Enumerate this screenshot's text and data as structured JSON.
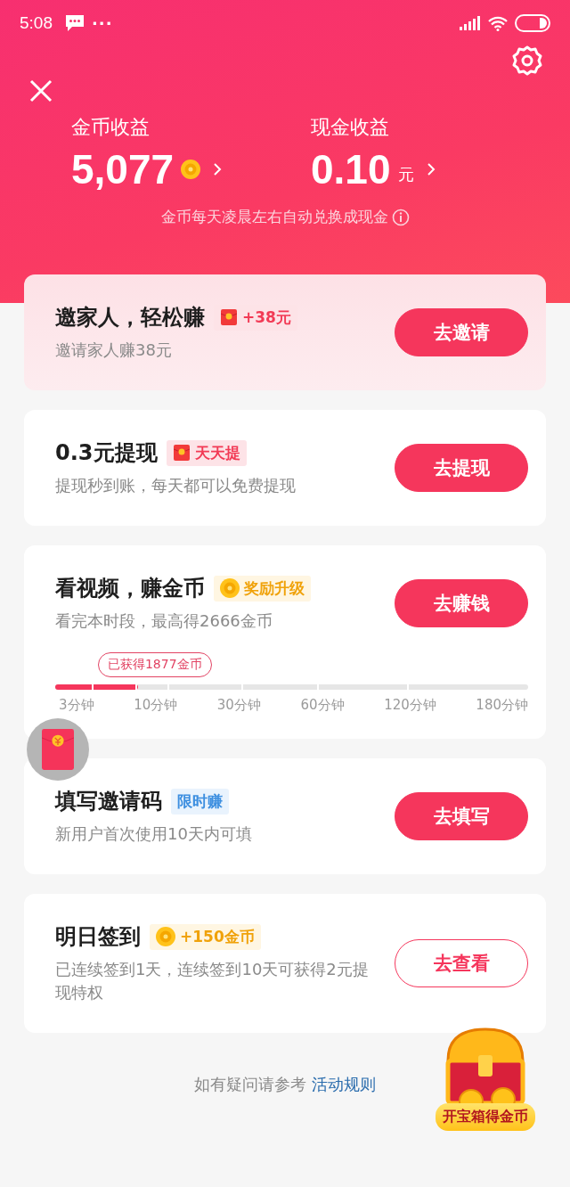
{
  "status_bar": {
    "time": "5:08",
    "more": "···"
  },
  "header": {
    "stats": [
      {
        "label": "金币收益",
        "value": "5,077",
        "kind": "coin"
      },
      {
        "label": "现金收益",
        "value": "0.10",
        "unit": "元",
        "kind": "cash"
      }
    ],
    "note": "金币每天凌晨左右自动兑换成现金"
  },
  "tasks": [
    {
      "title": "邀家人，轻松赚",
      "badge": {
        "text": "+38元",
        "kind": "redpacket"
      },
      "subtitle": "邀请家人赚38元",
      "button": {
        "label": "去邀请",
        "outlined": false
      },
      "highlighted": true
    },
    {
      "title": "0.3元提现",
      "badge": {
        "text": "天天提",
        "kind": "redpacket"
      },
      "subtitle": "提现秒到账，每天都可以免费提现",
      "button": {
        "label": "去提现",
        "outlined": false
      },
      "highlighted": false
    },
    {
      "title": "看视频，赚金币",
      "badge": {
        "text": "奖励升级",
        "kind": "coin"
      },
      "subtitle": "看完本时段，最高得2666金币",
      "button": {
        "label": "去赚钱",
        "outlined": false
      },
      "highlighted": false,
      "progress": {
        "level": 0.175,
        "tooltip": "已获得1877金币",
        "ticks": [
          "3分钟",
          "10分钟",
          "30分钟",
          "60分钟",
          "120分钟",
          "180分钟"
        ]
      }
    },
    {
      "title": "填写邀请码",
      "badge": {
        "text": "限时赚",
        "kind": "plain"
      },
      "subtitle": "新用户首次使用10天内可填",
      "button": {
        "label": "去填写",
        "outlined": false
      },
      "highlighted": false
    },
    {
      "title": "明日签到",
      "badge": {
        "text": "+150金币",
        "kind": "coin"
      },
      "subtitle": "已连续签到1天，连续签到10天可获得2元提现特权",
      "button": {
        "label": "去查看",
        "outlined": true
      },
      "highlighted": false
    }
  ],
  "footer": {
    "text": "如有疑问请参考",
    "link": "活动规则"
  },
  "treasure": {
    "label": "开宝箱得金币"
  }
}
